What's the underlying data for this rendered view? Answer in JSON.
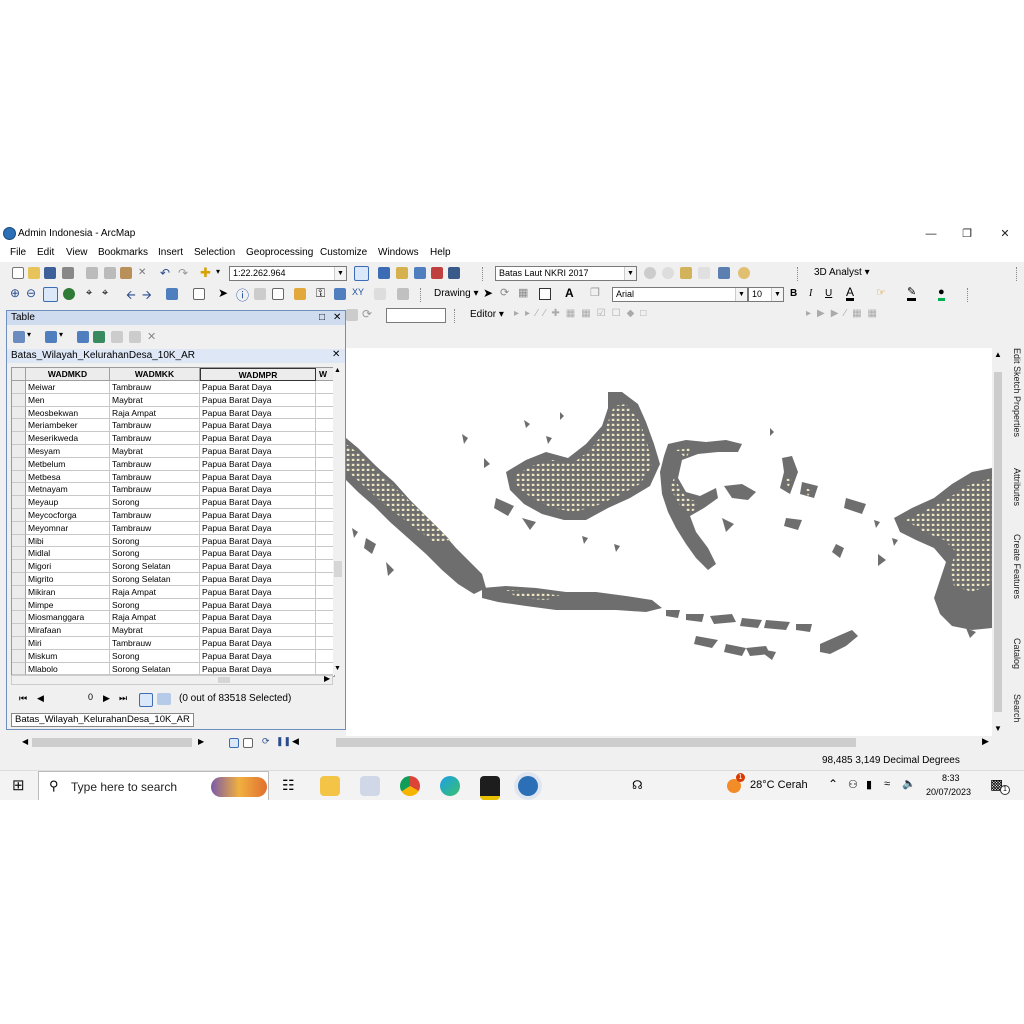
{
  "window": {
    "title": "Admin Indonesia - ArcMap"
  },
  "menu": [
    "File",
    "Edit",
    "View",
    "Bookmarks",
    "Insert",
    "Selection",
    "Geoprocessing",
    "Customize",
    "Windows",
    "Help"
  ],
  "toolbar": {
    "scale": "1:22.262.964",
    "layer_dropdown": "Batas Laut NKRI 2017",
    "analyst_3d": "3D Analyst",
    "drawing": "Drawing",
    "font_name": "Arial",
    "font_size": "10",
    "bold": "B",
    "italic": "I",
    "underline": "U",
    "editor": "Editor"
  },
  "table": {
    "window_title": "Table",
    "layer_name": "Batas_Wilayah_KelurahanDesa_10K_AR",
    "columns": [
      "WADMKD",
      "WADMKK",
      "WADMPR",
      "W"
    ],
    "rows": [
      [
        "Meiwar",
        "Tambrauw",
        "Papua Barat Daya"
      ],
      [
        "Men",
        "Maybrat",
        "Papua Barat Daya"
      ],
      [
        "Meosbekwan",
        "Raja Ampat",
        "Papua Barat Daya"
      ],
      [
        "Meriambeker",
        "Tambrauw",
        "Papua Barat Daya"
      ],
      [
        "Meserikweda",
        "Tambrauw",
        "Papua Barat Daya"
      ],
      [
        "Mesyam",
        "Maybrat",
        "Papua Barat Daya"
      ],
      [
        "Metbelum",
        "Tambrauw",
        "Papua Barat Daya"
      ],
      [
        "Metbesa",
        "Tambrauw",
        "Papua Barat Daya"
      ],
      [
        "Metnayam",
        "Tambrauw",
        "Papua Barat Daya"
      ],
      [
        "Meyaup",
        "Sorong",
        "Papua Barat Daya"
      ],
      [
        "Meycocforga",
        "Tambrauw",
        "Papua Barat Daya"
      ],
      [
        "Meyomnar",
        "Tambrauw",
        "Papua Barat Daya"
      ],
      [
        "Mibi",
        "Sorong",
        "Papua Barat Daya"
      ],
      [
        "Midlal",
        "Sorong",
        "Papua Barat Daya"
      ],
      [
        "Migori",
        "Sorong Selatan",
        "Papua Barat Daya"
      ],
      [
        "Migrito",
        "Sorong Selatan",
        "Papua Barat Daya"
      ],
      [
        "Mikiran",
        "Raja Ampat",
        "Papua Barat Daya"
      ],
      [
        "Mimpe",
        "Sorong",
        "Papua Barat Daya"
      ],
      [
        "Miosmanggara",
        "Raja Ampat",
        "Papua Barat Daya"
      ],
      [
        "Mirafaan",
        "Maybrat",
        "Papua Barat Daya"
      ],
      [
        "Miri",
        "Tambrauw",
        "Papua Barat Daya"
      ],
      [
        "Miskum",
        "Sorong",
        "Papua Barat Daya"
      ],
      [
        "Mlabolo",
        "Sorong Selatan",
        "Papua Barat Daya"
      ]
    ],
    "record_value": "0",
    "selection_status": "(0 out of 83518 Selected)",
    "tab_label": "Batas_Wilayah_KelurahanDesa_10K_AR"
  },
  "side_tabs": [
    "Edit Sketch Properties",
    "Attributes",
    "Create Features",
    "Catalog",
    "Search"
  ],
  "status": {
    "coordinates": "98,485  3,149 Decimal Degrees"
  },
  "taskbar": {
    "search_placeholder": "Type here to search",
    "weather": "28°C  Cerah",
    "weather_badge": "1",
    "time": "8:33",
    "date": "20/07/2023",
    "notification_count": "1"
  },
  "colors": {
    "land": "#6e6e6e",
    "villages": "#efe7c2",
    "titlebar_table": "#cfdcf0"
  }
}
